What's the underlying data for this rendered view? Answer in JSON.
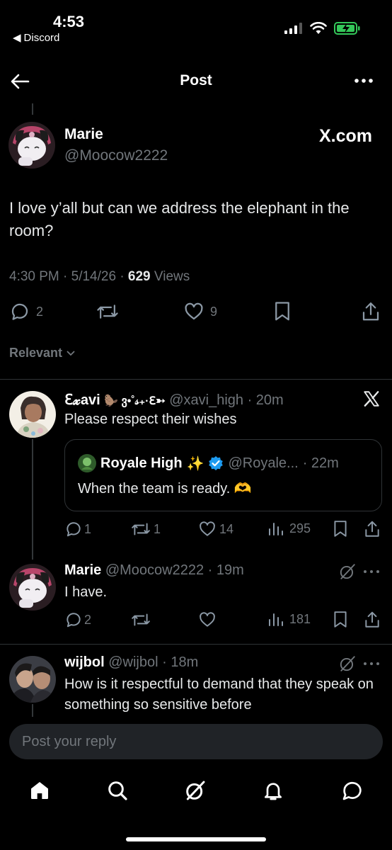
{
  "status_bar": {
    "time": "4:53",
    "back_app": "Discord"
  },
  "header": {
    "title": "Post"
  },
  "post": {
    "author_name": "Marie",
    "author_handle": "@Moocow2222",
    "source": "X.com",
    "text": "I love y’all but can we address the elephant in the room?",
    "time": "4:30 PM · 5/14/26 · ",
    "views_count": "629",
    "views_label": " Views",
    "replies": "2",
    "likes": "9"
  },
  "sort": {
    "label": "Relevant"
  },
  "replies": [
    {
      "name": "ℇ𝔁avi",
      "name_extra": "🦫 ვ•˚𝓈₊·ℇ➳",
      "handle": "@xavi_high",
      "time": "· 20m",
      "text": "Please respect their wishes",
      "quote": {
        "name": "Royale High",
        "sparkle": "✨",
        "handle": "@Royale...",
        "time": "· 22m",
        "text": "When the team is ready. 🫶"
      },
      "stats": {
        "replies": "1",
        "reposts": "1",
        "likes": "14",
        "views": "295"
      }
    },
    {
      "name": "Marie",
      "handle": "@Moocow2222",
      "time": "· 19m",
      "text": "I have.",
      "stats": {
        "replies": "2",
        "views": "181"
      }
    },
    {
      "name": "wijbol",
      "handle": "@wijbol",
      "time": "· 18m",
      "text": "How is it respectful to demand that they speak on something so sensitive before"
    }
  ],
  "composer": {
    "placeholder": "Post your reply"
  },
  "colors": {
    "background": "#000000",
    "muted": "#71767b",
    "verified": "#1d9bf0",
    "battery": "#34c759"
  }
}
